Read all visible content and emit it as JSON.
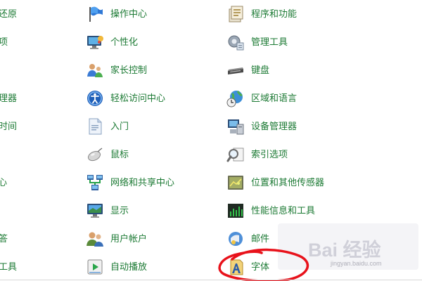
{
  "left_column": [
    {
      "name": "partial-item-restore",
      "label": "还原"
    },
    {
      "name": "partial-item-options",
      "label": "项"
    },
    {
      "name": "partial-item-manager",
      "label": "理器"
    },
    {
      "name": "partial-item-time",
      "label": "时间"
    },
    {
      "name": "partial-item-center",
      "label": "心"
    },
    {
      "name": "partial-item-answer",
      "label": "答"
    },
    {
      "name": "partial-item-tools",
      "label": "工具"
    }
  ],
  "middle_column": [
    {
      "name": "action-center",
      "label": "操作中心",
      "icon": "flag-icon"
    },
    {
      "name": "personalization",
      "label": "个性化",
      "icon": "monitor-paint-icon"
    },
    {
      "name": "parental-controls",
      "label": "家长控制",
      "icon": "family-icon"
    },
    {
      "name": "ease-of-access",
      "label": "轻松访问中心",
      "icon": "accessibility-icon"
    },
    {
      "name": "getting-started",
      "label": "入门",
      "icon": "document-icon"
    },
    {
      "name": "mouse",
      "label": "鼠标",
      "icon": "mouse-icon"
    },
    {
      "name": "network-sharing",
      "label": "网络和共享中心",
      "icon": "network-icon"
    },
    {
      "name": "display",
      "label": "显示",
      "icon": "display-icon"
    },
    {
      "name": "user-accounts",
      "label": "用户帐户",
      "icon": "users-icon"
    },
    {
      "name": "autoplay",
      "label": "自动播放",
      "icon": "autoplay-icon"
    }
  ],
  "right_column": [
    {
      "name": "programs-features",
      "label": "程序和功能",
      "icon": "programs-icon"
    },
    {
      "name": "admin-tools",
      "label": "管理工具",
      "icon": "admin-tools-icon"
    },
    {
      "name": "keyboard",
      "label": "键盘",
      "icon": "keyboard-icon"
    },
    {
      "name": "region-language",
      "label": "区域和语言",
      "icon": "globe-clock-icon"
    },
    {
      "name": "device-manager",
      "label": "设备管理器",
      "icon": "device-manager-icon"
    },
    {
      "name": "indexing-options",
      "label": "索引选项",
      "icon": "search-index-icon"
    },
    {
      "name": "location-sensors",
      "label": "位置和其他传感器",
      "icon": "sensor-icon"
    },
    {
      "name": "performance-info",
      "label": "性能信息和工具",
      "icon": "performance-icon"
    },
    {
      "name": "mail",
      "label": "邮件",
      "icon": "mail-icon"
    },
    {
      "name": "fonts",
      "label": "字体",
      "icon": "font-icon"
    }
  ],
  "watermark": {
    "brand": "Bai 经验",
    "url": "jingyan.baidu.com"
  },
  "colors": {
    "link": "#1c7a34",
    "annotation": "#e8121b"
  }
}
